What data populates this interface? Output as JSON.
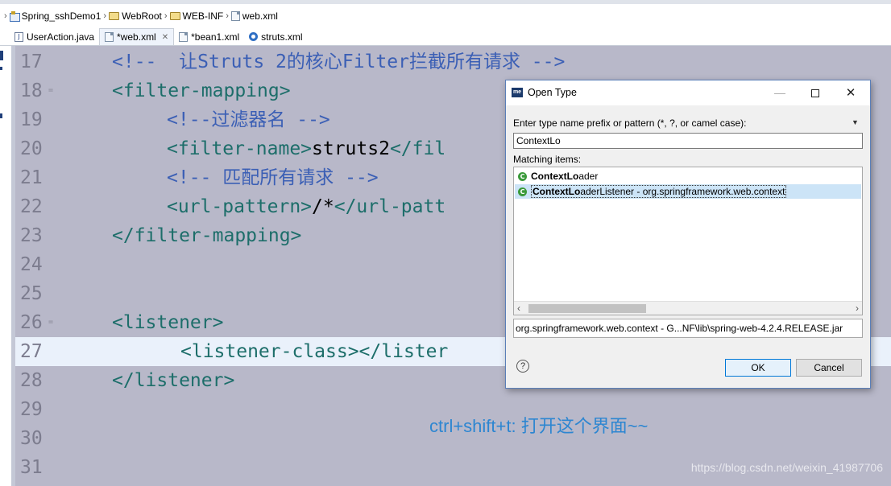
{
  "breadcrumb": {
    "items": [
      {
        "label": "Spring_sshDemo1",
        "icon": "project-icon"
      },
      {
        "label": "WebRoot",
        "icon": "folder-icon"
      },
      {
        "label": "WEB-INF",
        "icon": "folder-icon"
      },
      {
        "label": "web.xml",
        "icon": "xml-file-icon"
      }
    ],
    "separator": "›"
  },
  "tabs": [
    {
      "label": "UserAction.java",
      "icon": "java-file-icon",
      "active": false
    },
    {
      "label": "*web.xml",
      "icon": "xml-file-icon",
      "active": true,
      "close": "✕"
    },
    {
      "label": "*bean1.xml",
      "icon": "xml-file-icon",
      "active": false
    },
    {
      "label": "struts.xml",
      "icon": "gear-icon",
      "active": false
    }
  ],
  "editor": {
    "lines": [
      {
        "num": "17",
        "parts": [
          {
            "t": "<!--  ",
            "c": "cm"
          },
          {
            "t": "让Struts 2的核心Filter拦截所有请求 -->",
            "c": "cm"
          }
        ]
      },
      {
        "num": "18",
        "parts": [
          {
            "t": "<filter-mapping>",
            "c": "tag"
          }
        ]
      },
      {
        "num": "19",
        "parts": [
          {
            "t": "<!--过滤器名 -->",
            "c": "cm"
          }
        ]
      },
      {
        "num": "20",
        "parts": [
          {
            "t": "<filter-name>",
            "c": "tag"
          },
          {
            "t": "struts2",
            "c": "txt"
          },
          {
            "t": "</fil",
            "c": "tag"
          }
        ]
      },
      {
        "num": "21",
        "parts": [
          {
            "t": "<!-- 匹配所有请求 -->",
            "c": "cm"
          }
        ]
      },
      {
        "num": "22",
        "parts": [
          {
            "t": "<url-pattern>",
            "c": "tag"
          },
          {
            "t": "/*",
            "c": "txt"
          },
          {
            "t": "</url-patt",
            "c": "tag"
          }
        ]
      },
      {
        "num": "23",
        "parts": [
          {
            "t": "</filter-mapping>",
            "c": "tag"
          }
        ]
      },
      {
        "num": "24",
        "parts": []
      },
      {
        "num": "25",
        "parts": []
      },
      {
        "num": "26",
        "parts": [
          {
            "t": "<listener>",
            "c": "tag"
          }
        ]
      },
      {
        "num": "27",
        "parts": [
          {
            "t": "<listener-class></lister",
            "c": "tag"
          }
        ]
      },
      {
        "num": "28",
        "parts": [
          {
            "t": "</listener>",
            "c": "tag"
          }
        ]
      },
      {
        "num": "29",
        "parts": []
      },
      {
        "num": "30",
        "parts": []
      },
      {
        "num": "31",
        "parts": []
      }
    ],
    "current_line": "27",
    "annotation": "ctrl+shift+t:  打开这个界面~~",
    "watermark": "https://blog.csdn.net/weixin_41987706"
  },
  "dialog": {
    "title": "Open Type",
    "icon_text": "me",
    "prompt": "Enter type name prefix or pattern (*, ?, or camel case):",
    "input_value": "ContextLo",
    "matching_label": "Matching items:",
    "items": [
      {
        "bold": "ContextLo",
        "rest": "ader",
        "selected": false
      },
      {
        "bold": "ContextLo",
        "rest": "aderListener - org.springframework.web.context",
        "selected": true
      }
    ],
    "location": "org.springframework.web.context - G...NF\\lib\\spring-web-4.2.4.RELEASE.jar",
    "ok_label": "OK",
    "cancel_label": "Cancel",
    "help_label": "?",
    "minimize_glyph": "—",
    "close_glyph": "✕"
  },
  "colors": {
    "editor_bg": "#b8b8c9",
    "comment": "#3b5fb5",
    "tag": "#1d6e6a",
    "annotation": "#2d86d1",
    "selection": "#cce4f7"
  }
}
